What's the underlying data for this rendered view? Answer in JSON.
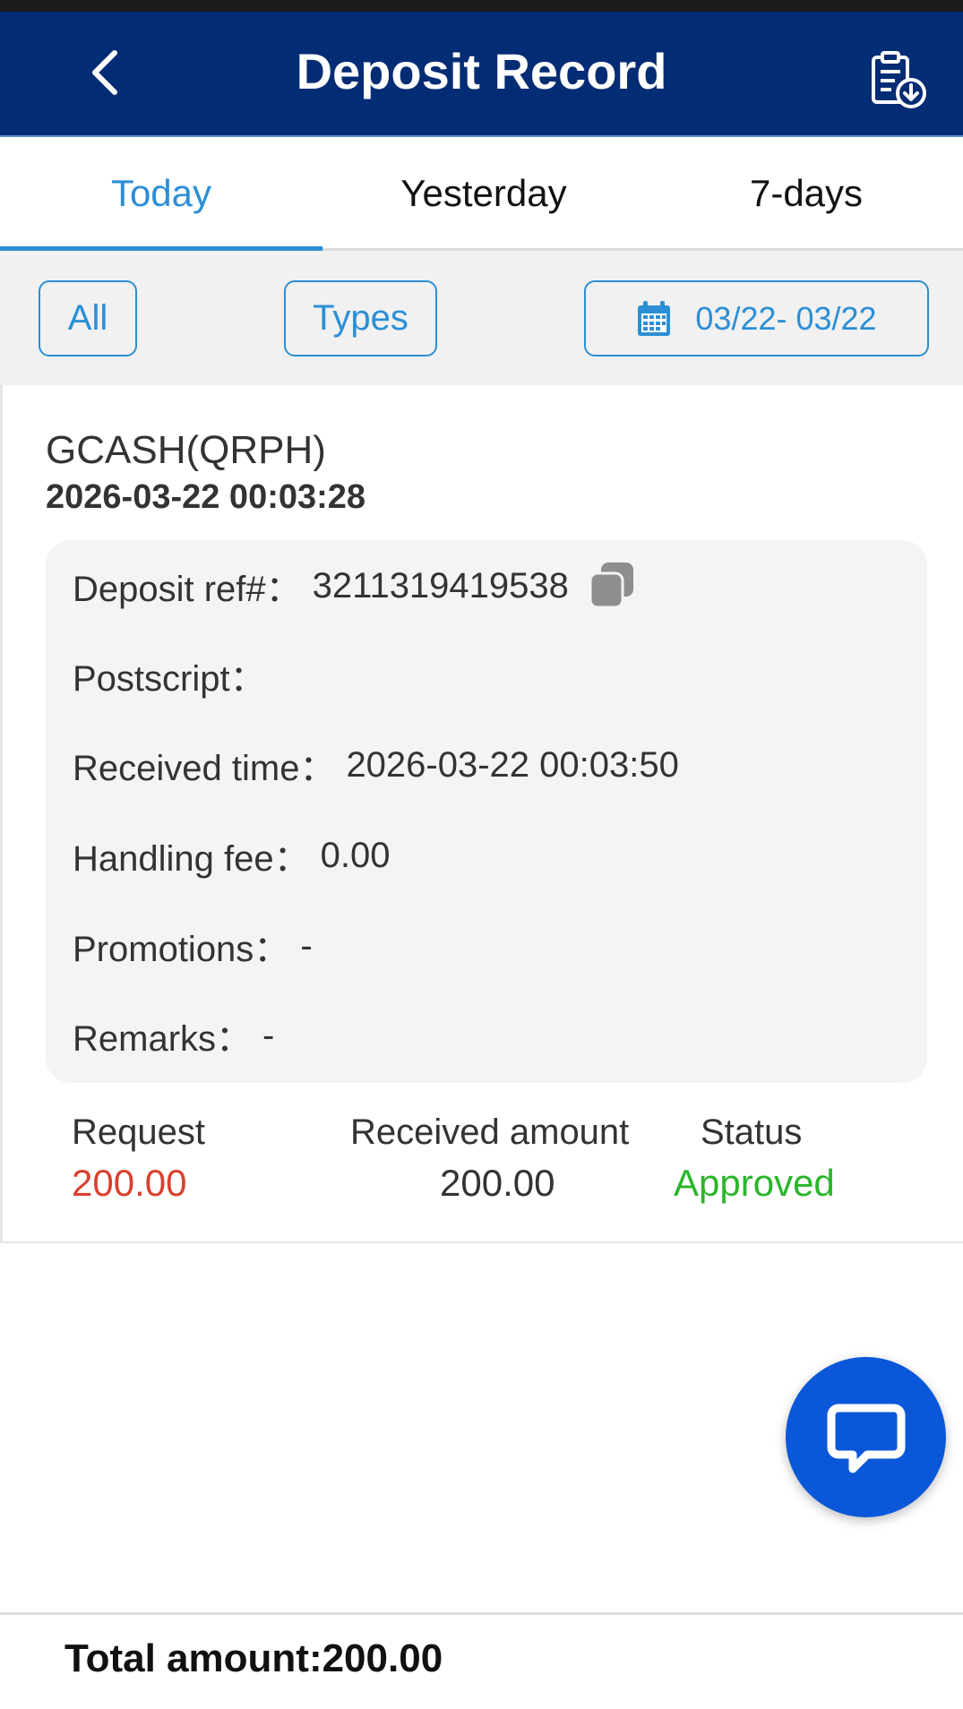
{
  "header": {
    "title": "Deposit Record",
    "back_icon": "chevron-left-icon",
    "export_icon": "clipboard-download-icon"
  },
  "tabs": [
    {
      "label": "Today",
      "active": true
    },
    {
      "label": "Yesterday",
      "active": false
    },
    {
      "label": "7-days",
      "active": false
    }
  ],
  "filters": {
    "all_label": "All",
    "types_label": "Types",
    "date_range": "03/22- 03/22",
    "date_icon": "calendar-icon"
  },
  "record": {
    "method": "GCASH(QRPH)",
    "created_time": "2026-03-22 00:03:28",
    "deposit_ref_label": "Deposit ref#：",
    "deposit_ref_value": "3211319419538",
    "postscript_label": "Postscript：",
    "postscript_value": "",
    "received_time_label": "Received time：",
    "received_time_value": "2026-03-22 00:03:50",
    "handling_fee_label": "Handling fee：",
    "handling_fee_value": "0.00",
    "promotions_label": "Promotions：",
    "promotions_value": "-",
    "remarks_label": "Remarks：",
    "remarks_value": "-",
    "request_label": "Request",
    "request_value": "200.00",
    "received_amount_label": "Received amount",
    "received_amount_value": "200.00",
    "status_label": "Status",
    "status_value": "Approved"
  },
  "footer": {
    "total": "Total amount:200.00"
  },
  "colors": {
    "header_bg": "#022c73",
    "accent": "#2b8fd6",
    "request_red": "#d9412e",
    "approved_green": "#2bb52b",
    "chat_fab": "#0b57d9"
  }
}
